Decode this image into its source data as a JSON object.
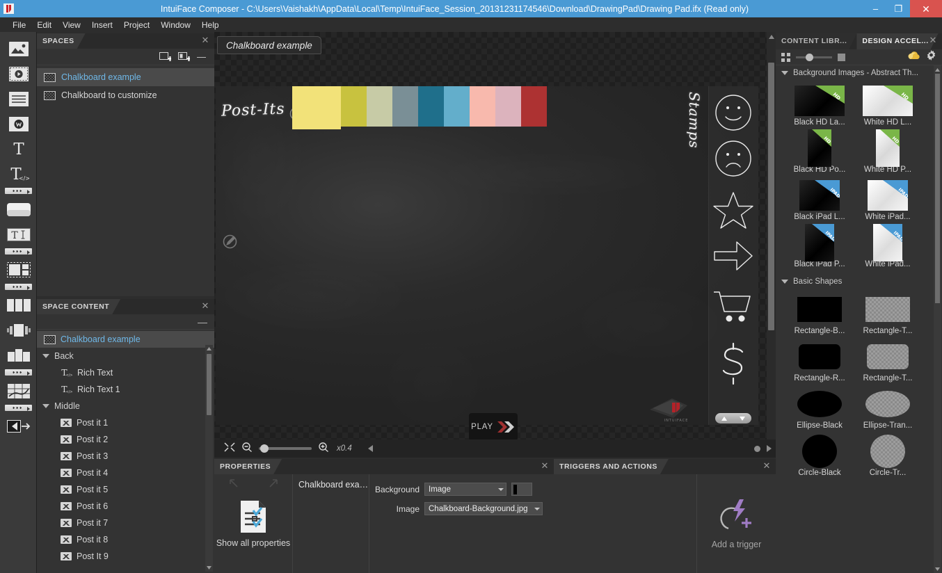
{
  "titlebar": {
    "title": "IntuiFace Composer - C:\\Users\\Vaishakh\\AppData\\Local\\Temp\\IntuiFace_Session_20131231174546\\Download\\DrawingPad\\Drawing Pad.ifx (Read only)",
    "minimize": "–",
    "maximize": "❐",
    "close": "✕",
    "accent_color": "#4a9ad4",
    "close_color": "#d9534f"
  },
  "menubar": {
    "items": [
      "File",
      "Edit",
      "View",
      "Insert",
      "Project",
      "Window",
      "Help"
    ]
  },
  "toolrail": {
    "tools": [
      {
        "name": "image-tool"
      },
      {
        "name": "video-tool"
      },
      {
        "name": "text-block-tool"
      },
      {
        "name": "web-browser-tool"
      },
      {
        "name": "text-tool"
      },
      {
        "name": "rich-text-tool"
      },
      {
        "name": "button-tool"
      },
      {
        "name": "text-input-tool"
      },
      {
        "name": "asset-grid-tool"
      },
      {
        "name": "columns-tool"
      },
      {
        "name": "carousel-tool"
      },
      {
        "name": "collection-tool"
      },
      {
        "name": "map-tool"
      },
      {
        "name": "navigation-tool"
      }
    ]
  },
  "spaces": {
    "tab": "SPACES",
    "close": "✕",
    "toolbar": {
      "add_space": "add-space-icon",
      "duplicate_space": "duplicate-space-icon",
      "remove_space": "—"
    },
    "items": [
      {
        "label": "Chalkboard example",
        "selected": true
      },
      {
        "label": "Chalkboard to customize",
        "selected": false
      }
    ]
  },
  "space_content": {
    "tab": "SPACE CONTENT",
    "close": "✕",
    "collapse": "—",
    "root": {
      "label": "Chalkboard example",
      "selected": true
    },
    "groups": [
      {
        "label": "Back",
        "children": [
          {
            "label": "Rich Text",
            "icon": "rich-text-icon"
          },
          {
            "label": "Rich Text 1",
            "icon": "rich-text-icon"
          }
        ]
      },
      {
        "label": "Middle",
        "children": [
          {
            "label": "Post it 1",
            "icon": "image-icon"
          },
          {
            "label": "Post it 2",
            "icon": "image-icon"
          },
          {
            "label": "Post it 3",
            "icon": "image-icon"
          },
          {
            "label": "Post it 4",
            "icon": "image-icon"
          },
          {
            "label": "Post it 5",
            "icon": "image-icon"
          },
          {
            "label": "Post it 6",
            "icon": "image-icon"
          },
          {
            "label": "Post it 7",
            "icon": "image-icon"
          },
          {
            "label": "Post it 8",
            "icon": "image-icon"
          },
          {
            "label": "Post It 9",
            "icon": "image-icon"
          }
        ]
      }
    ]
  },
  "canvas": {
    "tab_label": "Chalkboard example",
    "board": {
      "postits_label": "Post-Its",
      "stamps_label": "Stamps",
      "postit_colors": [
        "#f2e279",
        "#c8c23f",
        "#c7cba6",
        "#7a8f96",
        "#1f6f8b",
        "#63aecb",
        "#f8b9ad",
        "#dcb3bd",
        "#ad3232"
      ],
      "stamps": [
        "smiley-stamp",
        "sad-face-stamp",
        "star-stamp",
        "arrow-stamp",
        "cart-stamp",
        "dollar-stamp"
      ],
      "watermark": "INTUIFACE"
    },
    "play_button": "PLAY"
  },
  "zoombar": {
    "fit_icon": "fit-to-screen-icon",
    "zoom_out_icon": "zoom-out-icon",
    "zoom_in_icon": "zoom-in-icon",
    "zoom_value": "x0.4"
  },
  "properties": {
    "tab": "PROPERTIES",
    "close": "✕",
    "show_all_label": "Show all properties",
    "selected_object": "Chalkboard exam...",
    "rows": [
      {
        "label": "Background",
        "value": "Image",
        "has_color": true,
        "color": "#000000"
      },
      {
        "label": "Image",
        "value": "Chalkboard-Background.jpg",
        "has_color": false
      }
    ]
  },
  "triggers": {
    "tab": "TRIGGERS AND ACTIONS",
    "close": "✕",
    "add_trigger_label": "Add a trigger",
    "accent_color": "#a07cc5"
  },
  "library": {
    "tabs": [
      {
        "label": "CONTENT LIBR...",
        "active": false
      },
      {
        "label": "DESIGN ACCEL...",
        "active": true
      }
    ],
    "close": "✕",
    "toolbar": {
      "grid_view_icon": "grid-view-icon",
      "size_slider": "thumbnail-size-slider",
      "large_view_icon": "large-view-icon",
      "cloud_icon": "cloud-icon",
      "settings_icon": "gear-icon"
    },
    "sections": [
      {
        "title": "Background Images - Abstract Th...",
        "items": [
          {
            "caption": "Black HD La...",
            "tone": "black",
            "tag": "HD",
            "tag_color": "#7ab648",
            "orient": "landscape"
          },
          {
            "caption": "White HD L...",
            "tone": "white",
            "tag": "HD",
            "tag_color": "#7ab648",
            "orient": "landscape"
          },
          {
            "caption": "Black HD Po...",
            "tone": "black",
            "tag": "HD",
            "tag_color": "#7ab648",
            "orient": "portrait"
          },
          {
            "caption": "White HD P...",
            "tone": "white",
            "tag": "HD",
            "tag_color": "#7ab648",
            "orient": "portrait"
          },
          {
            "caption": "Black iPad L...",
            "tone": "black",
            "tag": "IPAD",
            "tag_color": "#4a9ad4",
            "orient": "landscape"
          },
          {
            "caption": "White iPad...",
            "tone": "white",
            "tag": "IPAD",
            "tag_color": "#4a9ad4",
            "orient": "landscape"
          },
          {
            "caption": "Black iPad P...",
            "tone": "black",
            "tag": "IPAD",
            "tag_color": "#4a9ad4",
            "orient": "portrait"
          },
          {
            "caption": "White iPad...",
            "tone": "white",
            "tag": "IPAD",
            "tag_color": "#4a9ad4",
            "orient": "portrait"
          }
        ]
      },
      {
        "title": "Basic Shapes",
        "items": [
          {
            "caption": "Rectangle-B...",
            "shape": "rect",
            "fill": "black"
          },
          {
            "caption": "Rectangle-T...",
            "shape": "rect",
            "fill": "transparent"
          },
          {
            "caption": "Rectangle-R...",
            "shape": "rounded-rect",
            "fill": "black"
          },
          {
            "caption": "Rectangle-T...",
            "shape": "rounded-rect",
            "fill": "transparent"
          },
          {
            "caption": "Ellipse-Black",
            "shape": "ellipse",
            "fill": "black"
          },
          {
            "caption": "Ellipse-Tran...",
            "shape": "ellipse",
            "fill": "transparent"
          },
          {
            "caption": "Circle-Black",
            "shape": "circle",
            "fill": "black"
          },
          {
            "caption": "Circle-Tr...",
            "shape": "circle",
            "fill": "transparent"
          }
        ]
      }
    ]
  }
}
